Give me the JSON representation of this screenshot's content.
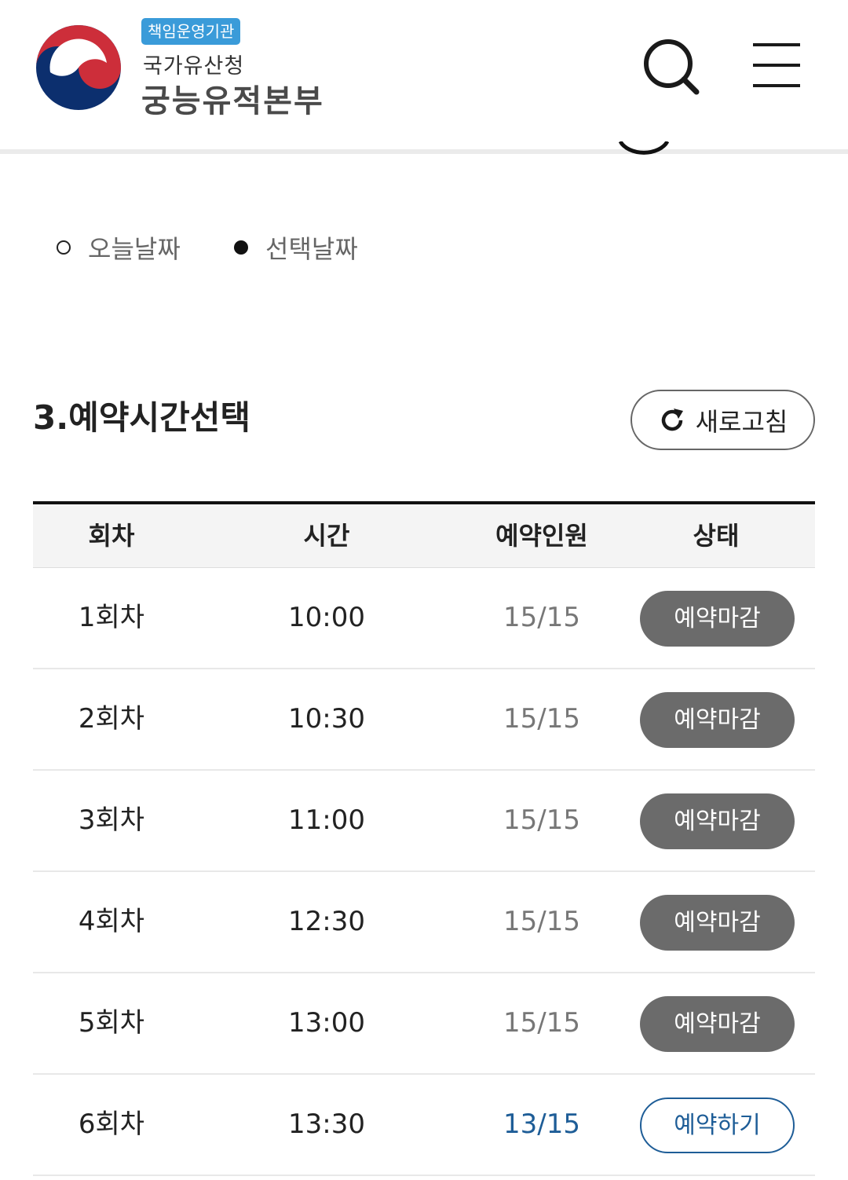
{
  "header": {
    "badge": "책임운영기관",
    "parent_agency": "국가유산청",
    "agency_name": "궁능유적본부",
    "search_icon": "search-icon",
    "menu_icon": "hamburger-menu-icon"
  },
  "legend": {
    "today_label": "오늘날짜",
    "selected_label": "선택날짜"
  },
  "section": {
    "title": "3.예약시간선택",
    "refresh_label": "새로고침"
  },
  "table": {
    "headers": [
      "회차",
      "시간",
      "예약인원",
      "상태"
    ],
    "rows": [
      {
        "session": "1회차",
        "time": "10:00",
        "count": "15/15",
        "status": "예약마감",
        "open": false
      },
      {
        "session": "2회차",
        "time": "10:30",
        "count": "15/15",
        "status": "예약마감",
        "open": false
      },
      {
        "session": "3회차",
        "time": "11:00",
        "count": "15/15",
        "status": "예약마감",
        "open": false
      },
      {
        "session": "4회차",
        "time": "12:30",
        "count": "15/15",
        "status": "예약마감",
        "open": false
      },
      {
        "session": "5회차",
        "time": "13:00",
        "count": "15/15",
        "status": "예약마감",
        "open": false
      },
      {
        "session": "6회차",
        "time": "13:30",
        "count": "13/15",
        "status": "예약하기",
        "open": true
      }
    ]
  },
  "colors": {
    "badge_blue": "#3a9bd9",
    "closed_gray": "#6b6b6b",
    "open_blue": "#1e5d97"
  }
}
